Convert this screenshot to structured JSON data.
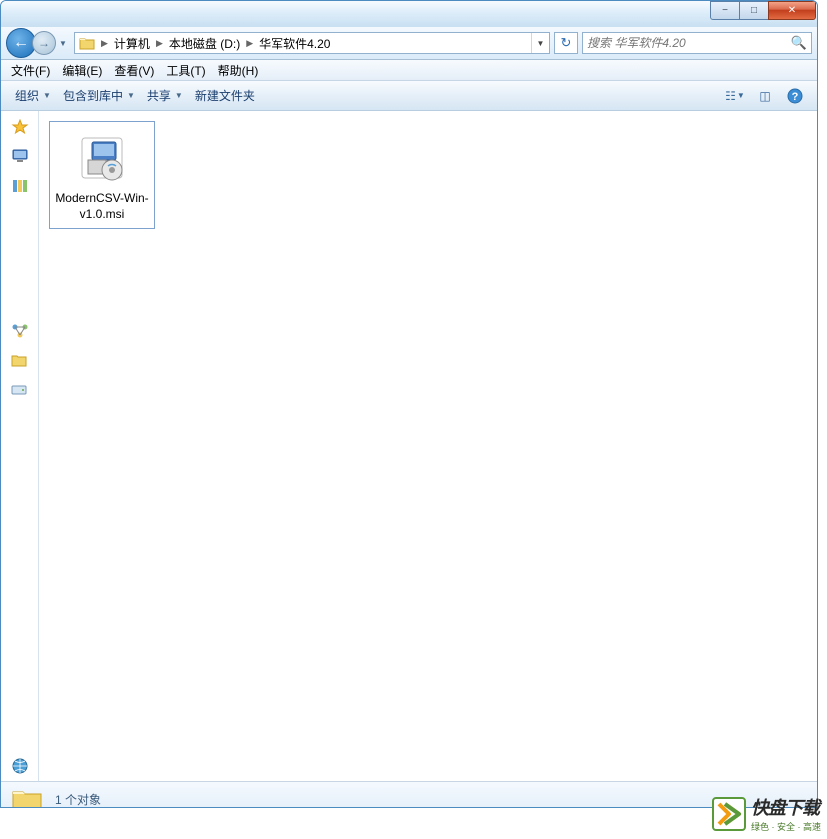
{
  "titlebar": {
    "minimize": "−",
    "maximize": "□",
    "close": "✕"
  },
  "nav": {
    "back": "←",
    "forward": "→"
  },
  "breadcrumbs": {
    "computer": "计算机",
    "drive": "本地磁盘 (D:)",
    "folder": "华军软件4.20"
  },
  "search": {
    "placeholder": "搜索 华军软件4.20"
  },
  "menubar": {
    "file": "文件(F)",
    "edit": "编辑(E)",
    "view": "查看(V)",
    "tools": "工具(T)",
    "help": "帮助(H)"
  },
  "toolbar": {
    "organize": "组织",
    "include": "包含到库中",
    "share": "共享",
    "newfolder": "新建文件夹"
  },
  "files": [
    {
      "name": "ModernCSV-Win-v1.0.msi"
    }
  ],
  "statusbar": {
    "count": "1 个对象"
  },
  "watermark": {
    "title": "快盘下载",
    "subtitle": "绿色 · 安全 · 高速"
  }
}
